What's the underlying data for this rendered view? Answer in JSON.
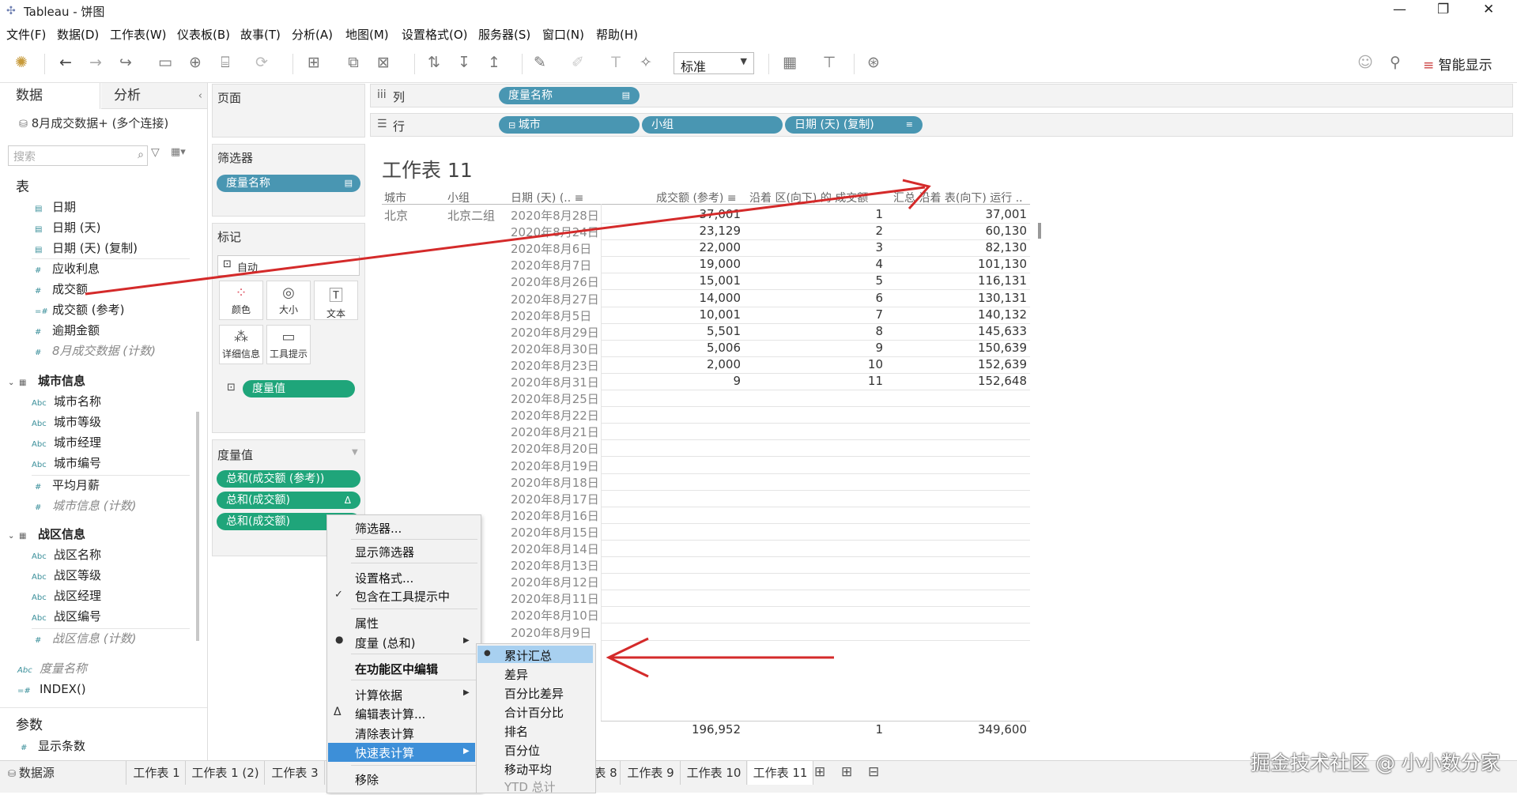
{
  "window": {
    "title": "Tableau - 饼图",
    "minimize": "—",
    "restore": "❐",
    "close": "✕"
  },
  "menu": [
    "文件(F)",
    "数据(D)",
    "工作表(W)",
    "仪表板(B)",
    "故事(T)",
    "分析(A)",
    "地图(M)",
    "设置格式(O)",
    "服务器(S)",
    "窗口(N)",
    "帮助(H)"
  ],
  "toolbar": {
    "fit_value": "标准",
    "show_me": "智能显示"
  },
  "data_pane": {
    "tab_data": "数据",
    "tab_analysis": "分析",
    "connection": "8月成交数据+ (多个连接)",
    "search_placeholder": "搜索",
    "tables_header": "表",
    "fields_main": [
      "日期",
      "日期 (天)",
      "日期 (天) (复制)",
      "应收利息",
      "成交额",
      "成交额 (参考)",
      "逾期金额",
      "8月成交数据 (计数)"
    ],
    "group_city": "城市信息",
    "fields_city": [
      "城市名称",
      "城市等级",
      "城市经理",
      "城市编号",
      "平均月薪",
      "城市信息 (计数)"
    ],
    "group_zone": "战区信息",
    "fields_zone": [
      "战区名称",
      "战区等级",
      "战区经理",
      "战区编号",
      "战区信息 (计数)"
    ],
    "field_measure_names": "度量名称",
    "field_index": "INDEX()",
    "params_header": "参数",
    "param_show": "显示条数"
  },
  "shelves": {
    "pages": "页面",
    "filters": "筛选器",
    "filter_pill": "度量名称",
    "marks": "标记",
    "marks_type": "自动",
    "marks_buttons": [
      "颜色",
      "大小",
      "文本",
      "详细信息",
      "工具提示"
    ],
    "marks_pill": "度量值",
    "measure_values": "度量值",
    "mv_pills": [
      "总和(成交额 (参考))",
      "总和(成交额)",
      "总和(成交额)"
    ],
    "columns_label": "列",
    "columns_pill": "度量名称",
    "rows_label": "行",
    "rows_pills": [
      "城市",
      "小组",
      "日期 (天) (复制)"
    ]
  },
  "sheet": {
    "title": "工作表 11",
    "headers": [
      "城市",
      "小组",
      "日期 (天) (..",
      "成交额 (参考)",
      "沿着 区(向下) 的 成交额",
      "汇总 沿着 表(向下) 运行 .."
    ],
    "city": "北京",
    "group": "北京二组",
    "dates": [
      "2020年8月28日",
      "2020年8月24日",
      "2020年8月6日",
      "2020年8月7日",
      "2020年8月26日",
      "2020年8月27日",
      "2020年8月5日",
      "2020年8月29日",
      "2020年8月30日",
      "2020年8月23日",
      "2020年8月31日",
      "2020年8月25日",
      "2020年8月22日",
      "2020年8月21日",
      "2020年8月20日",
      "2020年8月19日",
      "2020年8月18日",
      "2020年8月17日",
      "2020年8月16日",
      "2020年8月15日",
      "2020年8月14日",
      "2020年8月13日",
      "2020年8月12日",
      "2020年8月11日",
      "2020年8月10日",
      "2020年8月9日"
    ],
    "ref": [
      "37,001",
      "23,129",
      "22,000",
      "19,000",
      "15,001",
      "14,000",
      "10,001",
      "5,501",
      "5,006",
      "2,000",
      "9"
    ],
    "rank": [
      "1",
      "2",
      "3",
      "4",
      "5",
      "6",
      "7",
      "8",
      "9",
      "10",
      "11"
    ],
    "running": [
      "37,001",
      "60,130",
      "82,130",
      "101,130",
      "116,131",
      "130,131",
      "140,132",
      "145,633",
      "150,639",
      "152,639",
      "152,648"
    ],
    "footer": {
      "ref": "196,952",
      "rank": "1",
      "running": "349,600"
    }
  },
  "context_menu": {
    "items": [
      "筛选器...",
      "显示筛选器",
      "设置格式...",
      "包含在工具提示中",
      "属性",
      "度量 (总和)",
      "在功能区中编辑",
      "计算依据",
      "编辑表计算...",
      "清除表计算",
      "快速表计算",
      "移除"
    ],
    "submenu": [
      "累计汇总",
      "差异",
      "百分比差异",
      "合计百分比",
      "排名",
      "百分位",
      "移动平均",
      "YTD 总计"
    ]
  },
  "tabs": [
    "数据源",
    "工作表 1",
    "工作表 1 (2)",
    "工作表 3",
    "表 8",
    "工作表 9",
    "工作表 10",
    "工作表 11"
  ],
  "watermark": "掘金技术社区 @ 小小数分家",
  "colors": {
    "pill_blue": "#4996b2",
    "pill_green": "#1fa57a",
    "menu_highlight": "#3d8fd8",
    "submenu_highlight": "#a8d0f0",
    "arrow": "#d42a2a"
  }
}
